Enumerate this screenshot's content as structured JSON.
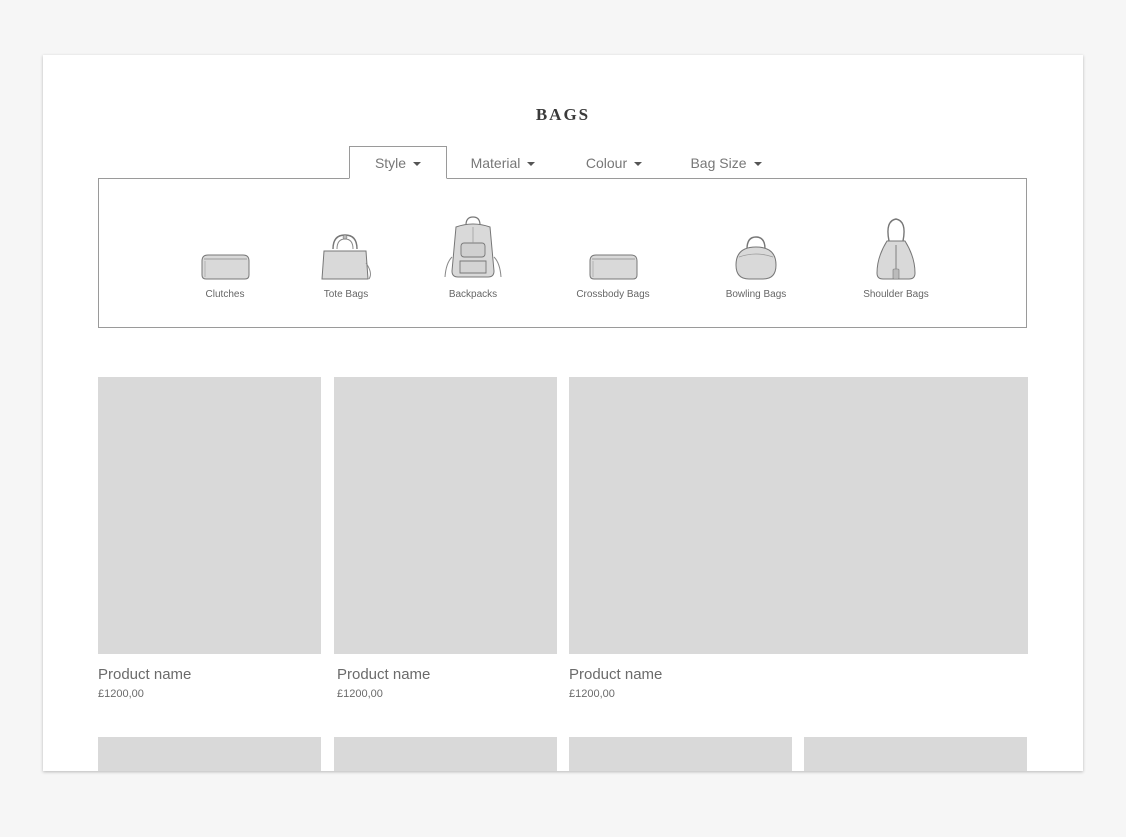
{
  "page": {
    "title": "BAGS"
  },
  "filters": {
    "tabs": [
      {
        "label": "Style"
      },
      {
        "label": "Material"
      },
      {
        "label": "Colour"
      },
      {
        "label": "Bag Size"
      }
    ],
    "active_tab": "Style",
    "style_options": [
      {
        "label": "Clutches",
        "icon": "clutch-icon"
      },
      {
        "label": "Tote Bags",
        "icon": "tote-bag-icon"
      },
      {
        "label": "Backpacks",
        "icon": "backpack-icon"
      },
      {
        "label": "Crossbody Bags",
        "icon": "crossbody-bag-icon"
      },
      {
        "label": "Bowling Bags",
        "icon": "bowling-bag-icon"
      },
      {
        "label": "Shoulder Bags",
        "icon": "shoulder-bag-icon"
      }
    ]
  },
  "products": [
    {
      "name": "Product name",
      "price": "£1200,00"
    },
    {
      "name": "Product name",
      "price": "£1200,00"
    },
    {
      "name": "Product name",
      "price": "£1200,00"
    }
  ],
  "colors": {
    "placeholder": "#d9d9d9",
    "background": "#f6f6f6",
    "border": "#9a9a9a"
  }
}
